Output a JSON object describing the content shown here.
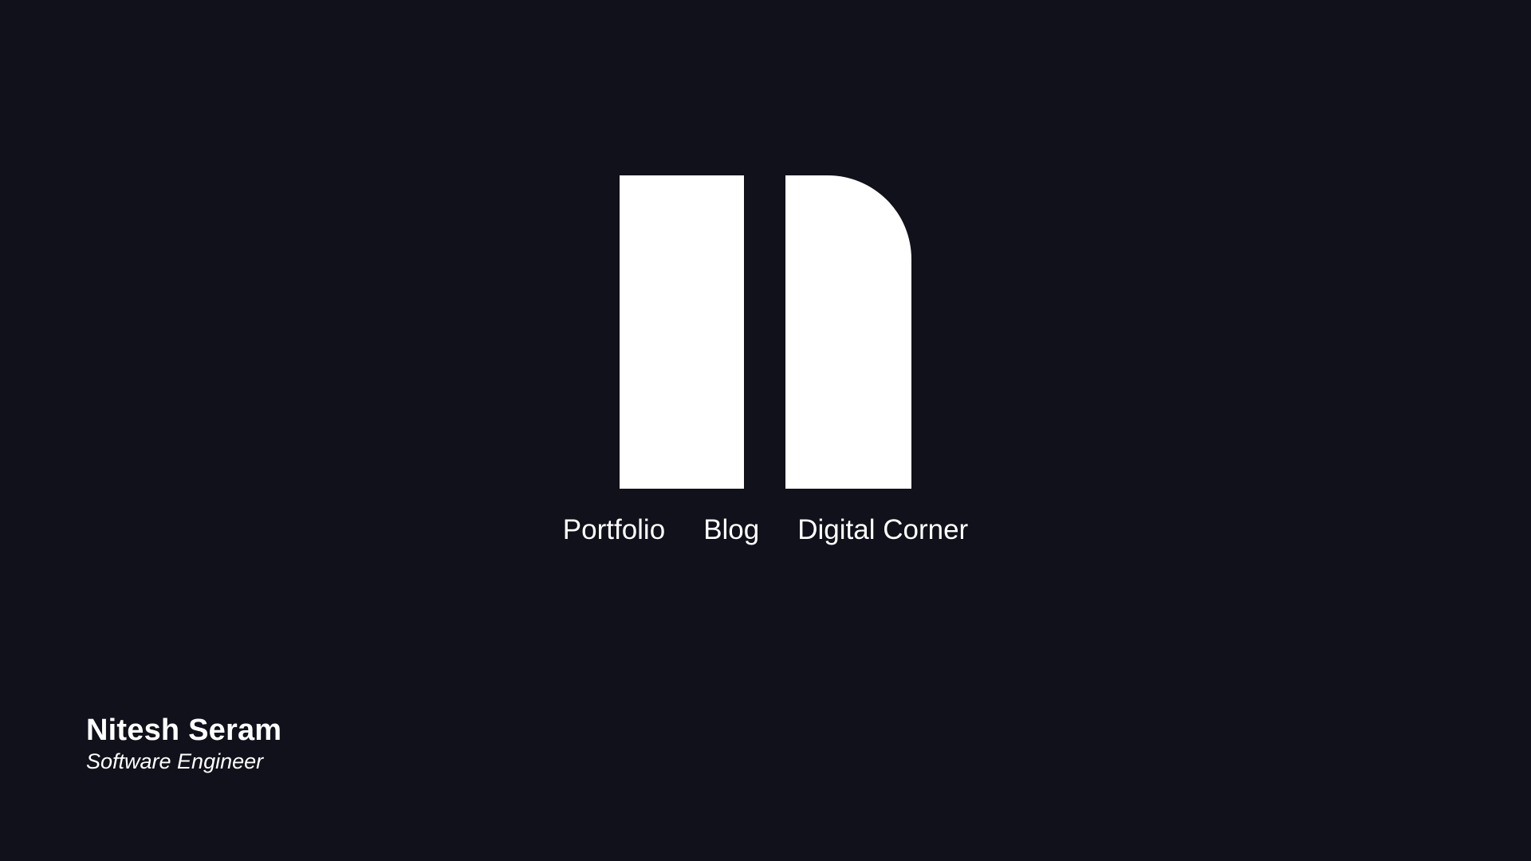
{
  "logo": {
    "icon": "nitesh-logo-mark",
    "color": "#ffffff"
  },
  "nav": {
    "items": [
      {
        "label": "Portfolio"
      },
      {
        "label": "Blog"
      },
      {
        "label": "Digital Corner"
      }
    ]
  },
  "identity": {
    "name": "Nitesh Seram",
    "role": "Software Engineer"
  },
  "theme": {
    "background": "#10111a",
    "foreground": "#ffffff"
  }
}
